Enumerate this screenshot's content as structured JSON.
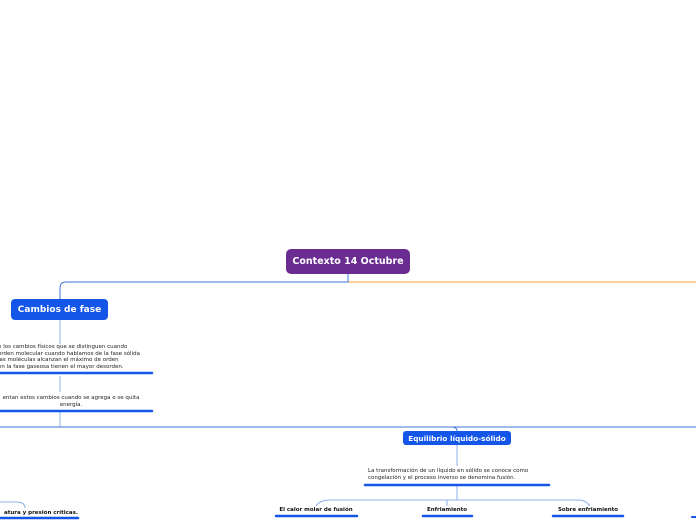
{
  "mindmap": {
    "root": {
      "label": "Contexto 14 Octubre",
      "color": "#6a2c91"
    },
    "branch_colors": {
      "left": "#3f74d9",
      "right": "#f0a030",
      "underline": "#1456e8"
    },
    "topics": [
      {
        "label": "Cambios de fase",
        "notes": [
          "n los cambios físicos que se distinguen cuando\n orden molecular cuando hablamos de la fase sólida\nlas moléculas alcanzan el máximo de orden\nen la fase gaseosa tienen el mayor desorden.",
          "entan estos cambios cuando se agrega o se quita\nenergía."
        ]
      },
      {
        "label": "Equilibrio líquido-sólido",
        "note": "La transformación de un líquido en sólido se conoce como\ncongelación y el proceso inverso se denomina fusión.",
        "children": [
          "El calor molar de fusión",
          "Enfriamiento",
          "Sobre enfriamiento"
        ]
      }
    ],
    "partial_label": "atura y presión críticas."
  }
}
